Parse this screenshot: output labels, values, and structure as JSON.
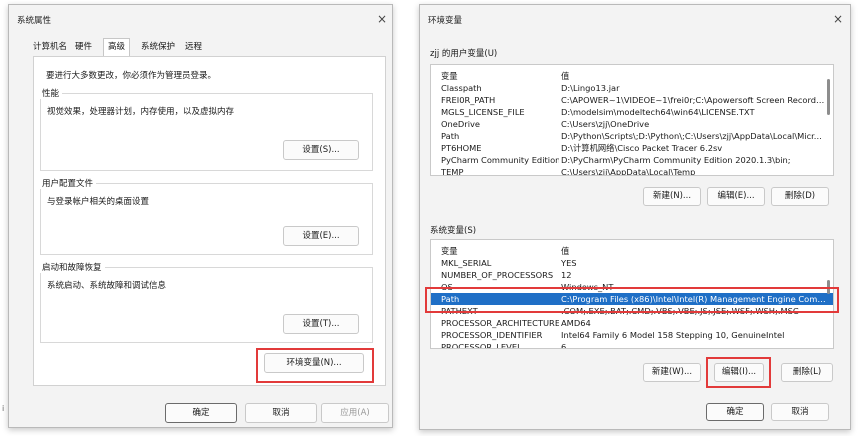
{
  "sys_props": {
    "title": "系统属性",
    "close_icon": "×",
    "tabs": [
      "计算机名",
      "硬件",
      "高级",
      "系统保护",
      "远程"
    ],
    "admin_note": "要进行大多数更改，你必须作为管理员登录。",
    "performance": {
      "title": "性能",
      "desc": "视觉效果，处理器计划，内存使用，以及虚拟内存",
      "button": "设置(S)..."
    },
    "user_profile": {
      "title": "用户配置文件",
      "desc": "与登录帐户相关的桌面设置",
      "button": "设置(E)..."
    },
    "startup": {
      "title": "启动和故障恢复",
      "desc": "系统启动、系统故障和调试信息",
      "button": "设置(T)..."
    },
    "env_button": "环境变量(N)...",
    "ok": "确定",
    "cancel": "取消",
    "apply": "应用(A)",
    "edge_mark": "i"
  },
  "env_vars": {
    "title": "环境变量",
    "close_icon": "×",
    "user_section_label": "zjj 的用户变量(U)",
    "headers": {
      "var": "变量",
      "val": "值"
    },
    "user_vars": [
      {
        "name": "Classpath",
        "value": "D:\\Lingo13.jar"
      },
      {
        "name": "FREI0R_PATH",
        "value": "C:\\APOWER~1\\VIDEOE~1\\frei0r;C:\\Apowersoft Screen Recorde..."
      },
      {
        "name": "MGLS_LICENSE_FILE",
        "value": "D:\\modelsim\\modeltech64\\win64\\LICENSE.TXT"
      },
      {
        "name": "OneDrive",
        "value": "C:\\Users\\zjj\\OneDrive"
      },
      {
        "name": "Path",
        "value": "D:\\Python\\Scripts\\;D:\\Python\\;C:\\Users\\zjj\\AppData\\Local\\Micr..."
      },
      {
        "name": "PT6HOME",
        "value": "D:\\计算机网络\\Cisco Packet Tracer 6.2sv"
      },
      {
        "name": "PyCharm Community Edition",
        "value": "D:\\PyCharm\\PyCharm Community Edition 2020.1.3\\bin;"
      },
      {
        "name": "TEMP",
        "value": "C:\\Users\\zjj\\AppData\\Local\\Temp"
      }
    ],
    "user_buttons": {
      "new": "新建(N)...",
      "edit": "编辑(E)...",
      "delete": "删除(D)"
    },
    "sys_section_label": "系统变量(S)",
    "sys_vars": [
      {
        "name": "MKL_SERIAL",
        "value": "YES"
      },
      {
        "name": "NUMBER_OF_PROCESSORS",
        "value": "12"
      },
      {
        "name": "OS",
        "value": "Windows_NT"
      },
      {
        "name": "Path",
        "value": "C:\\Program Files (x86)\\Intel\\Intel(R) Management Engine Comp...",
        "selected": true
      },
      {
        "name": "PATHEXT",
        "value": ".COM;.EXE;.BAT;.CMD;.VBS;.VBE;.JS;.JSE;.WSF;.WSH;.MSC"
      },
      {
        "name": "PROCESSOR_ARCHITECTURE",
        "value": "AMD64"
      },
      {
        "name": "PROCESSOR_IDENTIFIER",
        "value": "Intel64 Family 6 Model 158 Stepping 10, GenuineIntel"
      },
      {
        "name": "PROCESSOR_LEVEL",
        "value": "6"
      }
    ],
    "sys_buttons": {
      "new": "新建(W)...",
      "edit": "编辑(I)...",
      "delete": "删除(L)"
    },
    "ok": "确定",
    "cancel": "取消"
  }
}
